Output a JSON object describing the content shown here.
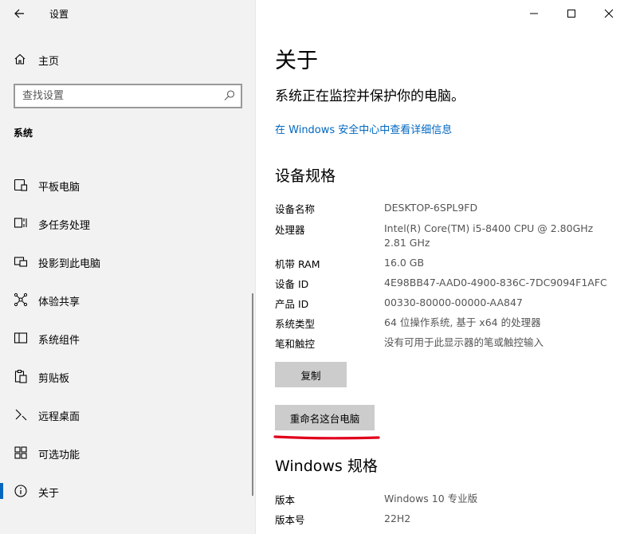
{
  "window": {
    "title": "设置",
    "controls": [
      "minimize-icon",
      "maximize-icon",
      "close-icon"
    ]
  },
  "sidebar": {
    "home_label": "主页",
    "search_placeholder": "查找设置",
    "section_title": "系统",
    "items": [
      {
        "label": "平板电脑",
        "icon": "tablet-icon"
      },
      {
        "label": "多任务处理",
        "icon": "multitasking-icon"
      },
      {
        "label": "投影到此电脑",
        "icon": "projecting-icon"
      },
      {
        "label": "体验共享",
        "icon": "shared-experiences-icon"
      },
      {
        "label": "系统组件",
        "icon": "system-components-icon"
      },
      {
        "label": "剪贴板",
        "icon": "clipboard-icon"
      },
      {
        "label": "远程桌面",
        "icon": "remote-desktop-icon"
      },
      {
        "label": "可选功能",
        "icon": "optional-features-icon"
      },
      {
        "label": "关于",
        "icon": "info-icon",
        "active": true
      }
    ]
  },
  "main": {
    "title": "关于",
    "protection_text": "系统正在监控并保护你的电脑。",
    "security_link": "在 Windows 安全中心中查看详细信息",
    "device_specs": {
      "heading": "设备规格",
      "rows": [
        {
          "label": "设备名称",
          "value": "DESKTOP-6SPL9FD"
        },
        {
          "label": "处理器",
          "value": "Intel(R) Core(TM) i5-8400 CPU @ 2.80GHz",
          "value2": "2.81 GHz"
        },
        {
          "label": "机带 RAM",
          "value": "16.0 GB"
        },
        {
          "label": "设备 ID",
          "value": "4E98BB47-AAD0-4900-836C-7DC9094F1AFC"
        },
        {
          "label": "产品 ID",
          "value": "00330-80000-00000-AA847"
        },
        {
          "label": "系统类型",
          "value": "64 位操作系统, 基于 x64 的处理器"
        },
        {
          "label": "笔和触控",
          "value": "没有可用于此显示器的笔或触控输入"
        }
      ],
      "copy_button": "复制",
      "rename_button": "重命名这台电脑"
    },
    "windows_specs": {
      "heading": "Windows 规格",
      "rows": [
        {
          "label": "版本",
          "value": "Windows 10 专业版"
        },
        {
          "label": "版本号",
          "value": "22H2"
        }
      ]
    }
  },
  "colors": {
    "accent": "#0067c0",
    "annotation": "#e0001b",
    "sidebar_bg": "#f2f2f2",
    "button_bg": "#cccccc"
  }
}
